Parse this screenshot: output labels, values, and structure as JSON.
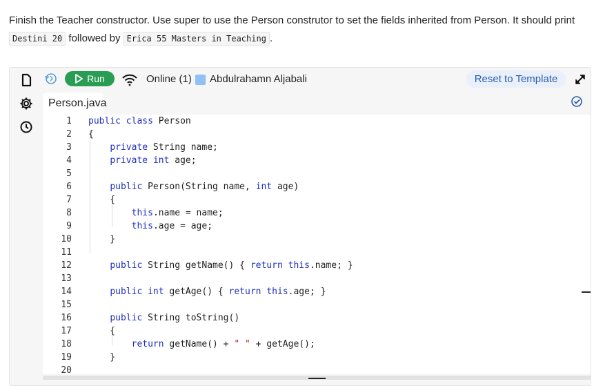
{
  "instruction": {
    "text_before": "Finish the Teacher constructor. Use super to use the Person construtor to set the fields inherited from Person. It should print",
    "code1": "Destini 20",
    "text_middle": "followed by",
    "code2": "Erica 55 Masters in Teaching",
    "text_after": "."
  },
  "toolbar": {
    "run_label": "Run",
    "online_label": "Online (1)",
    "user_name": "Abdulrahamn Aljabali",
    "reset_label": "Reset to Template"
  },
  "tab": {
    "label": "Person.java"
  },
  "colors": {
    "run_green": "#2a9d55",
    "user_square": "#8fc1f5",
    "keyword_blue": "#1f2fbf",
    "string_red": "#b02020"
  },
  "code_lines": [
    {
      "n": "1",
      "text": "public class Person"
    },
    {
      "n": "2",
      "text": "{"
    },
    {
      "n": "3",
      "text": "    private String name;"
    },
    {
      "n": "4",
      "text": "    private int age;"
    },
    {
      "n": "5",
      "text": ""
    },
    {
      "n": "6",
      "text": "    public Person(String name, int age)"
    },
    {
      "n": "7",
      "text": "    {"
    },
    {
      "n": "8",
      "text": "        this.name = name;"
    },
    {
      "n": "9",
      "text": "        this.age = age;"
    },
    {
      "n": "10",
      "text": "    }"
    },
    {
      "n": "11",
      "text": ""
    },
    {
      "n": "12",
      "text": "    public String getName() { return this.name; }"
    },
    {
      "n": "13",
      "text": ""
    },
    {
      "n": "14",
      "text": "    public int getAge() { return this.age; }"
    },
    {
      "n": "15",
      "text": ""
    },
    {
      "n": "16",
      "text": "    public String toString()"
    },
    {
      "n": "17",
      "text": "    {"
    },
    {
      "n": "18",
      "text": "        return getName() + \" \" + getAge();"
    },
    {
      "n": "19",
      "text": "    }"
    },
    {
      "n": "20",
      "text": ""
    }
  ]
}
